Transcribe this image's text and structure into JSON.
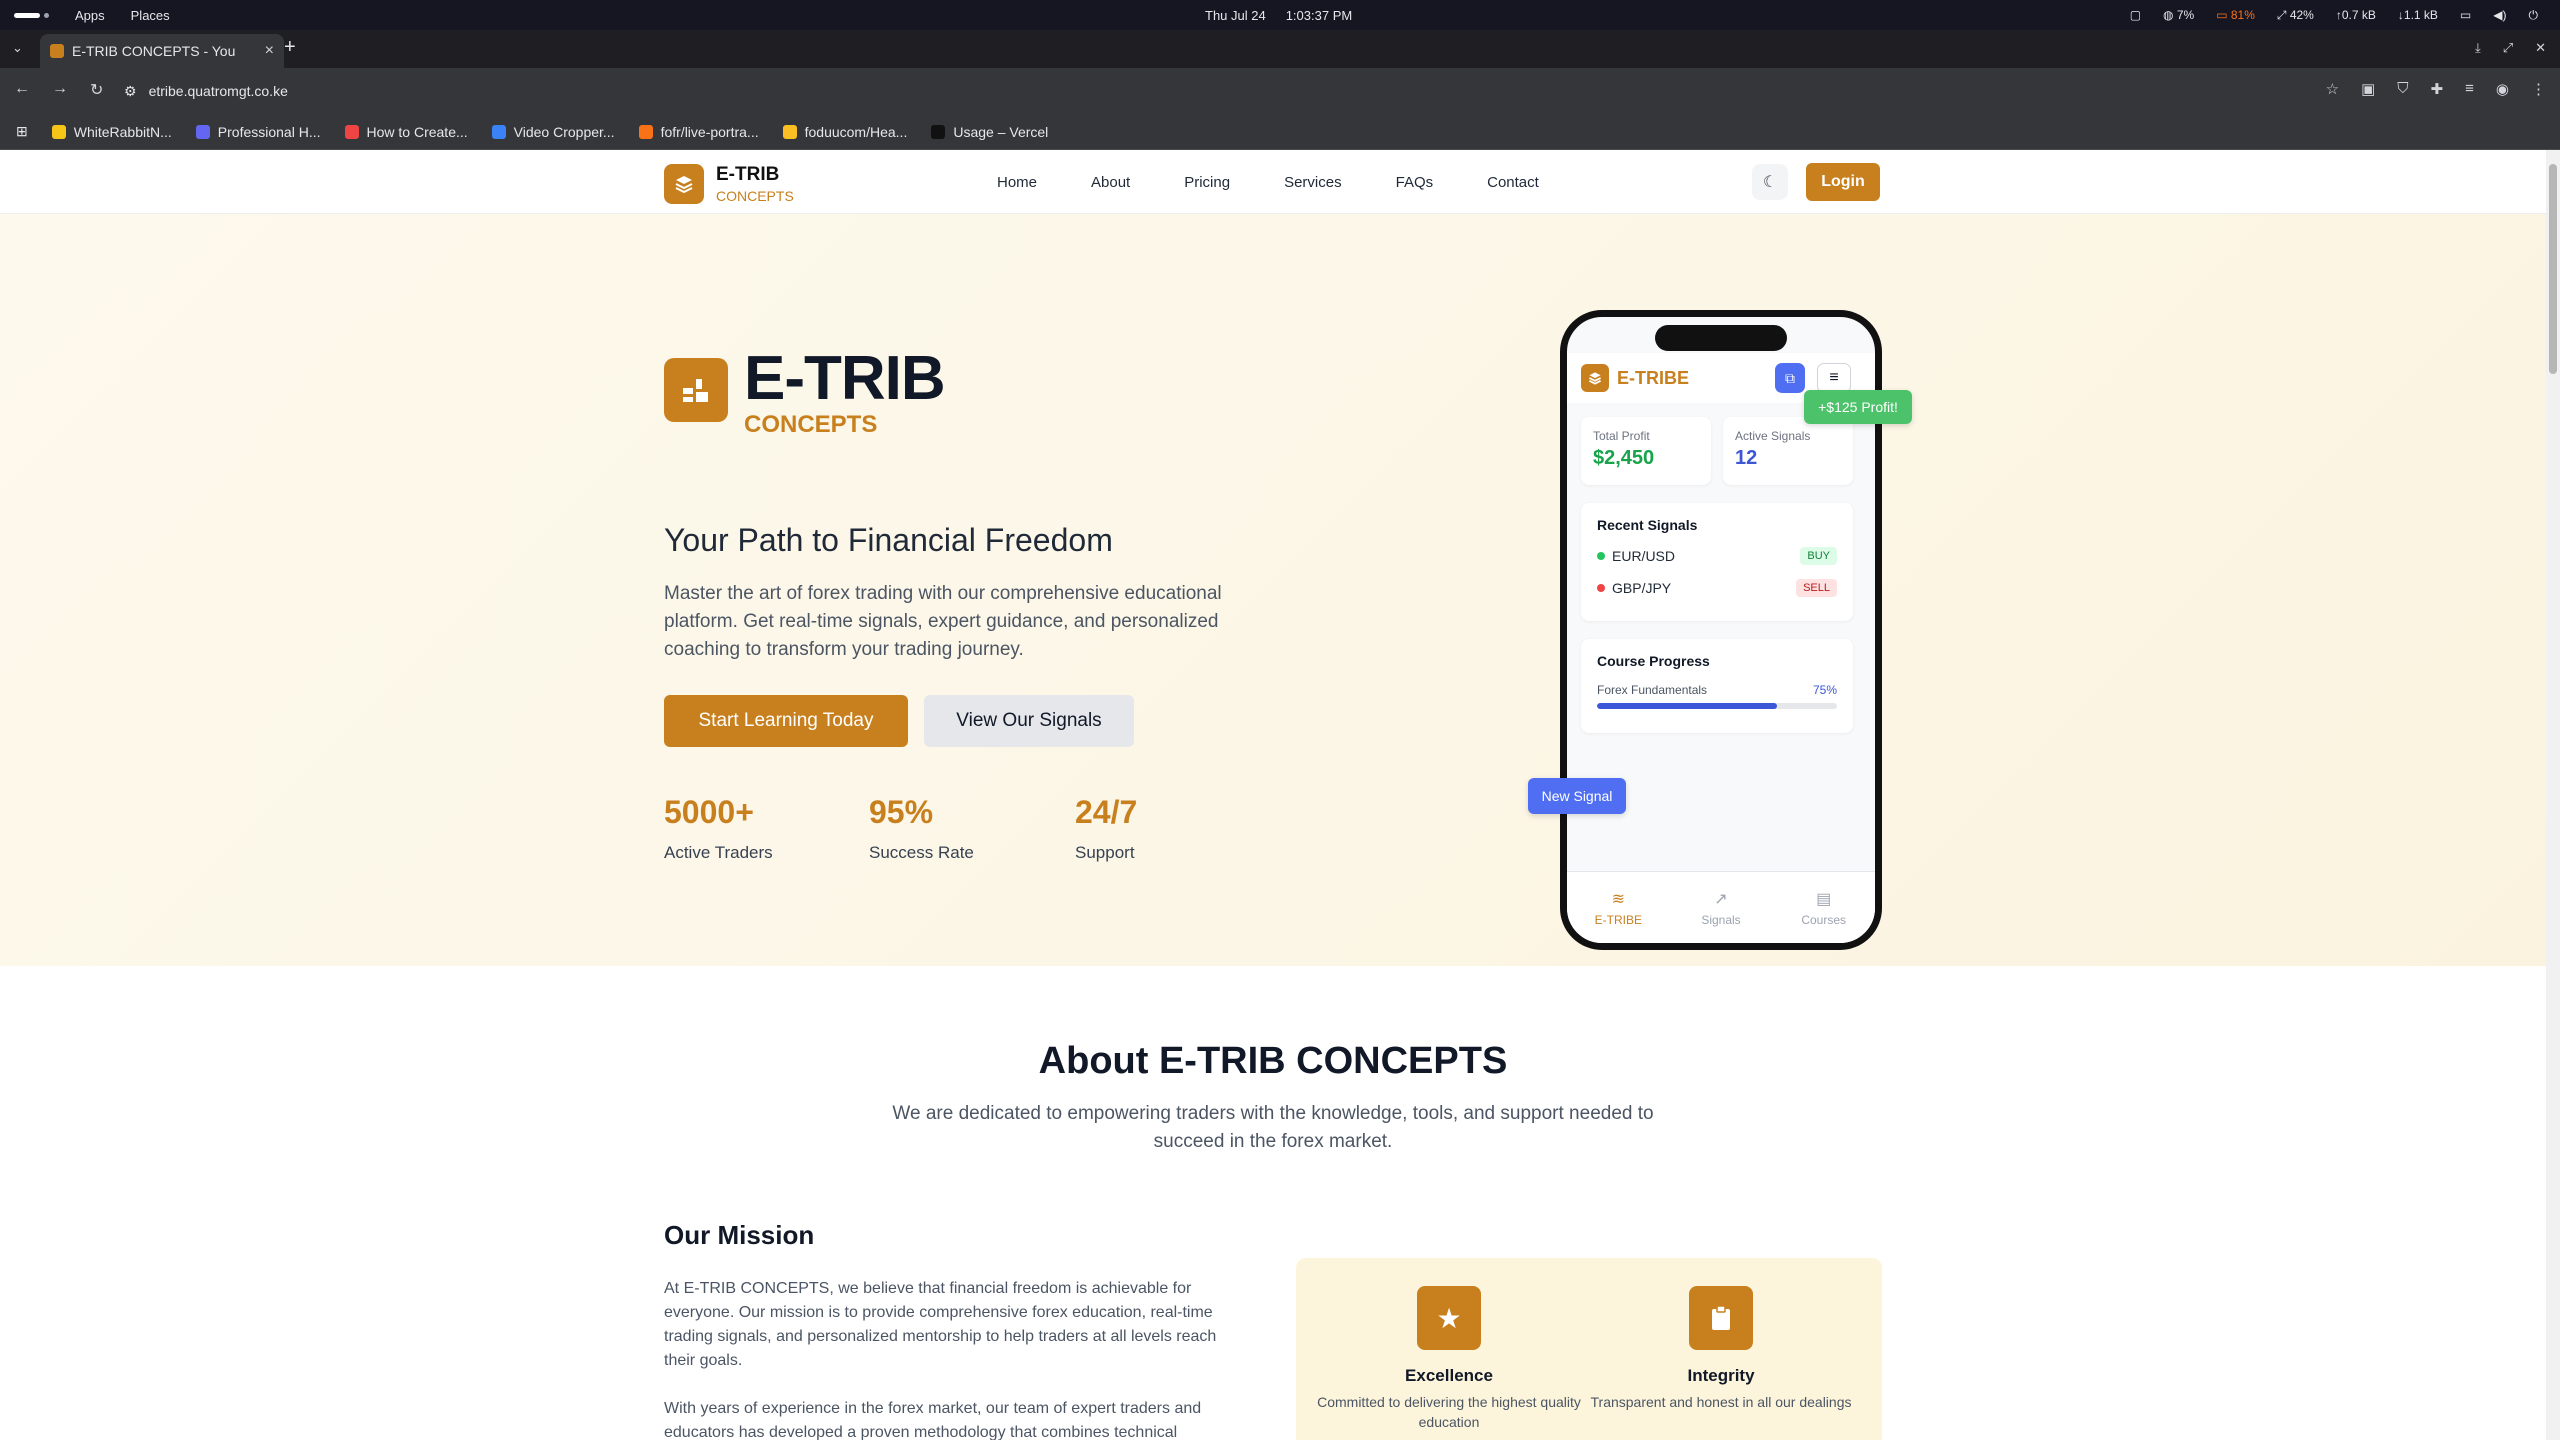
{
  "os": {
    "menus": [
      "Apps",
      "Places"
    ],
    "date": "Thu Jul 24",
    "time": "1:03:37 PM",
    "cpu": "7%",
    "battery": "81%",
    "volume": "42%",
    "net_up": "0.7 kB",
    "net_down": "1.1 kB"
  },
  "browser": {
    "tab_title": "E-TRIB CONCEPTS - You",
    "url": "etribe.quatromgt.co.ke",
    "bookmarks": [
      "WhiteRabbitN...",
      "Professional H...",
      "How to Create...",
      "Video Cropper...",
      "fofr/live-portra...",
      "foduucom/Hea...",
      "Usage – Vercel"
    ],
    "bookmark_colors": [
      "#f5c518",
      "#6366f1",
      "#ef4444",
      "#3b82f6",
      "#f97316",
      "#fbbf24",
      "#111111"
    ]
  },
  "site": {
    "logo_title": "E-TRIB",
    "logo_sub": "CONCEPTS",
    "nav": [
      "Home",
      "About",
      "Pricing",
      "Services",
      "FAQs",
      "Contact"
    ],
    "login": "Login",
    "accent": "#c8801f"
  },
  "hero": {
    "title": "E-TRIB",
    "subtitle": "CONCEPTS",
    "tagline": "Your Path to Financial Freedom",
    "description": "Master the art of forex trading with our comprehensive educational platform. Get real-time signals, expert guidance, and personalized coaching to transform your trading journey.",
    "cta_primary": "Start Learning Today",
    "cta_secondary": "View Our Signals",
    "stats": [
      {
        "value": "5000+",
        "label": "Active Traders"
      },
      {
        "value": "95%",
        "label": "Success Rate"
      },
      {
        "value": "24/7",
        "label": "Support"
      }
    ]
  },
  "phone": {
    "app_name": "E-TRIBE",
    "profit_label": "Total Profit",
    "profit_value": "$2,450",
    "signals_label": "Active Signals",
    "signals_value": "12",
    "recent_title": "Recent Signals",
    "signals": [
      {
        "pair": "EUR/USD",
        "action": "BUY"
      },
      {
        "pair": "GBP/JPY",
        "action": "SELL"
      }
    ],
    "progress_title": "Course Progress",
    "course_name": "Forex Fundamentals",
    "course_pct": "75%",
    "course_fraction": 0.75,
    "nav": [
      "E-TRIBE",
      "Signals",
      "Courses"
    ],
    "toast_profit": "+$125 Profit!",
    "toast_signal": "New Signal"
  },
  "about": {
    "heading": "About E-TRIB CONCEPTS",
    "intro": "We are dedicated to empowering traders with the knowledge, tools, and support needed to succeed in the forex market.",
    "mission_heading": "Our Mission",
    "mission_p1": "At E-TRIB CONCEPTS, we believe that financial freedom is achievable for everyone. Our mission is to provide comprehensive forex education, real-time trading signals, and personalized mentorship to help traders at all levels reach their goals.",
    "mission_p2": "With years of experience in the forex market, our team of expert traders and educators has developed a proven methodology that combines technical",
    "values": [
      {
        "title": "Excellence",
        "desc": "Committed to delivering the highest quality education",
        "icon": "star-icon"
      },
      {
        "title": "Integrity",
        "desc": "Transparent and honest in all our dealings",
        "icon": "clipboard-icon"
      }
    ]
  }
}
